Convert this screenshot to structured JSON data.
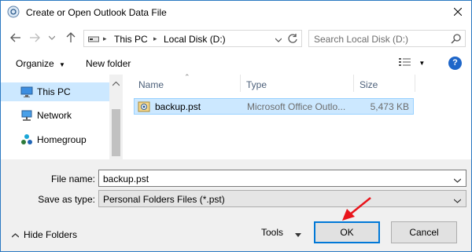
{
  "window": {
    "title": "Create or Open Outlook Data File"
  },
  "address_bar": {
    "path": [
      "This PC",
      "Local Disk (D:)"
    ],
    "search_placeholder": "Search Local Disk (D:)"
  },
  "toolbar": {
    "organize_label": "Organize",
    "new_folder_label": "New folder",
    "help_label": "?"
  },
  "nav_pane": {
    "items": [
      {
        "label": "This PC",
        "icon": "monitor-icon",
        "selected": true
      },
      {
        "label": "Network",
        "icon": "network-icon",
        "selected": false
      },
      {
        "label": "Homegroup",
        "icon": "homegroup-icon",
        "selected": false
      }
    ]
  },
  "file_list": {
    "columns": [
      "Name",
      "Type",
      "Size"
    ],
    "rows": [
      {
        "name": "backup.pst",
        "type": "Microsoft Office Outlo...",
        "size": "5,473 KB",
        "selected": true
      }
    ]
  },
  "fields": {
    "file_name_label": "File name:",
    "file_name_value": "backup.pst",
    "save_as_type_label": "Save as type:",
    "save_as_type_value": "Personal Folders Files (*.pst)"
  },
  "footer": {
    "hide_folders_label": "Hide Folders",
    "tools_label": "Tools",
    "ok_label": "OK",
    "cancel_label": "Cancel"
  },
  "colors": {
    "accent": "#0078d7",
    "selection": "#cce8ff",
    "annotation_arrow": "#e8141b"
  }
}
